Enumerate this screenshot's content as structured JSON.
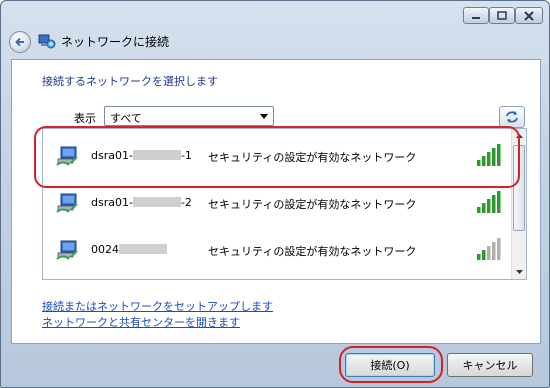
{
  "window": {
    "title": "ネットワークに接続",
    "controls": [
      "minimize",
      "maximize",
      "close"
    ]
  },
  "content": {
    "heading": "接続するネットワークを選択します",
    "show_label": "表示",
    "filter_value": "すべて"
  },
  "networks": [
    {
      "name_prefix": "dsra01-",
      "name_suffix": "-1",
      "security": "セキュリティの設定が有効なネットワーク",
      "signal_bars": 5,
      "highlighted": true
    },
    {
      "name_prefix": "dsra01-",
      "name_suffix": "-2",
      "security": "セキュリティの設定が有効なネットワーク",
      "signal_bars": 5,
      "highlighted": false
    },
    {
      "name_prefix": "0024",
      "name_suffix": "",
      "security": "セキュリティの設定が有効なネットワーク",
      "signal_bars": 2,
      "highlighted": false
    }
  ],
  "links": {
    "setup": "接続またはネットワークをセットアップします",
    "sharing_center": "ネットワークと共有センターを開きます"
  },
  "buttons": {
    "connect": "接続(O)",
    "cancel": "キャンセル"
  },
  "colors": {
    "highlight": "#d2232a",
    "link": "#1a4dbd",
    "heading": "#1e3a8a",
    "signal_on": "#2e9a2e",
    "signal_off": "#b0b0b0"
  }
}
